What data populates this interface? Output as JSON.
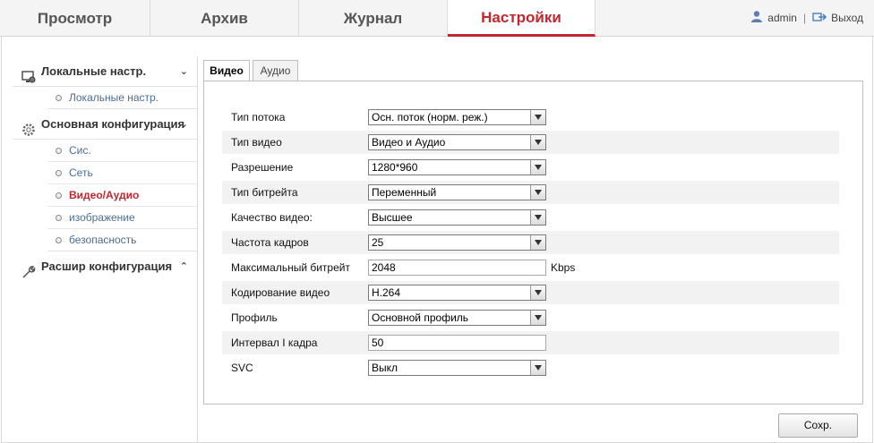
{
  "topnav": {
    "tabs": [
      "Просмотр",
      "Архив",
      "Журнал",
      "Настройки"
    ],
    "active_tab": "Настройки",
    "user": "admin",
    "separator": "|",
    "logout": "Выход",
    "accent_color": "#c0282f"
  },
  "sidebar": {
    "local": {
      "title": "Локальные настр.",
      "icon": "monitor-settings-icon",
      "chevron": "⌄",
      "items": [
        "Локальные настр."
      ]
    },
    "basic": {
      "title": "Основная конфигурация",
      "icon": "gear-icon",
      "chevron": "⌄",
      "items": [
        "Сис.",
        "Сеть",
        "Видео/Аудио",
        "изображение",
        "безопасность"
      ],
      "active_item": "Видео/Аудио"
    },
    "advanced": {
      "title": "Расшир конфигурация",
      "icon": "wrench-icon",
      "chevron": "⌃"
    }
  },
  "tabs": {
    "video": "Видео",
    "audio": "Аудио",
    "active": "Видео"
  },
  "form": {
    "stream_type": {
      "label": "Тип потока",
      "value": "Осн. поток (норм. реж.)"
    },
    "video_type": {
      "label": "Тип видео",
      "value": "Видео и Аудио"
    },
    "resolution": {
      "label": "Разрешение",
      "value": "1280*960"
    },
    "bitrate_type": {
      "label": "Тип битрейта",
      "value": "Переменный"
    },
    "video_quality": {
      "label": "Качество видео:",
      "value": "Высшее"
    },
    "frame_rate": {
      "label": "Частота кадров",
      "value": "25"
    },
    "max_bitrate": {
      "label": "Максимальный битрейт",
      "value": "2048",
      "unit": "Kbps"
    },
    "video_encoding": {
      "label": "Кодирование видео",
      "value": "H.264"
    },
    "profile": {
      "label": "Профиль",
      "value": "Основной профиль"
    },
    "i_frame_interval": {
      "label": "Интервал I кадра",
      "value": "50"
    },
    "svc": {
      "label": "SVC",
      "value": "Выкл"
    }
  },
  "save_label": "Сохр."
}
